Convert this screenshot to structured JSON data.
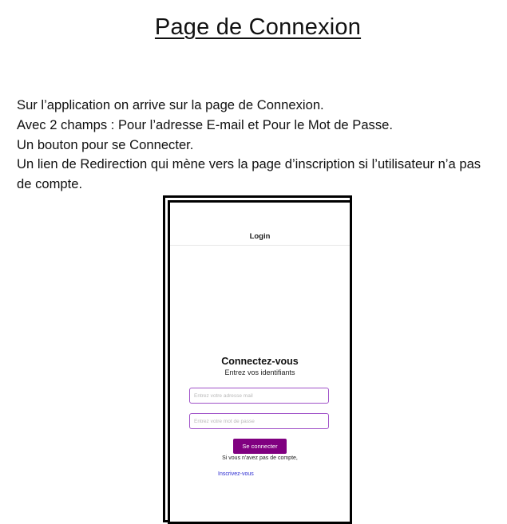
{
  "document": {
    "title": "Page de Connexion",
    "paragraph_lines": [
      "Sur l’application on arrive sur la page de Connexion.",
      "Avec 2 champs : Pour l’adresse E-mail et Pour le Mot de Passe.",
      "Un bouton pour se Connecter.",
      "Un lien de Redirection qui mène vers la page d’inscription si l’utilisateur n’a pas de compte."
    ]
  },
  "app": {
    "header_title": "Login",
    "heading": "Connectez-vous",
    "subtitle": "Entrez vos identifiants",
    "email_field": {
      "placeholder": "Entrez votre adresse mail",
      "value": ""
    },
    "password_field": {
      "placeholder": "Entrez votre mot de passe",
      "value": ""
    },
    "connect_button_label": "Se connecter",
    "no_account_text": "Si vous n'avez pas de compte,",
    "register_link_label": "Inscrivez-vous",
    "colors": {
      "button_background": "#800080",
      "field_border": "#a052c8",
      "link": "#2b2bd1"
    }
  }
}
